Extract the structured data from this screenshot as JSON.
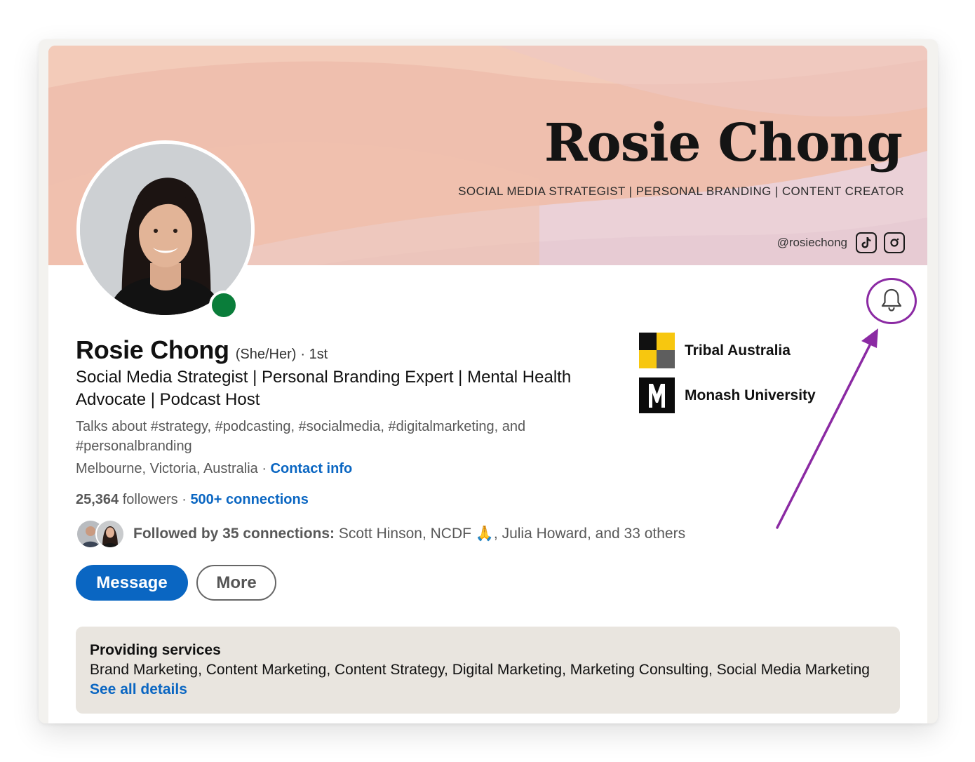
{
  "banner": {
    "name": "Rosie Chong",
    "tagline": "SOCIAL MEDIA STRATEGIST | PERSONAL BRANDING | CONTENT CREATOR",
    "handle": "@rosiechong",
    "social_icons": [
      "tiktok-icon",
      "instagram-icon"
    ],
    "colors": {
      "base": "#efbfae",
      "wave_pink": "#ecd3d9",
      "wave_peach": "#f5d0bc"
    }
  },
  "profile": {
    "name": "Rosie Chong",
    "pronouns": "(She/Her)",
    "degree": "· 1st",
    "headline": "Social Media Strategist | Personal Branding Expert | Mental Health Advocate | Podcast Host",
    "talks_about": "Talks about #strategy, #podcasting, #socialmedia, #digitalmarketing, and #personalbranding",
    "location": "Melbourne, Victoria, Australia",
    "location_separator": " · ",
    "contact_info": "Contact info",
    "followers_count": "25,364",
    "followers_label": " followers",
    "stats_separator": " · ",
    "connections": "500+ connections",
    "followed_by_label": "Followed by 35 connections:",
    "followed_by_names": " Scott Hinson, NCDF 🙏, Julia Howard, and 33 others",
    "presence": "online"
  },
  "actions": {
    "message": "Message",
    "more": "More",
    "bell": "bell-icon"
  },
  "experience": [
    {
      "label": "Tribal Australia",
      "icon": "tribal-australia-logo"
    },
    {
      "label": "Monash University",
      "icon": "monash-university-logo"
    }
  ],
  "services": {
    "title": "Providing services",
    "list": "Brand Marketing, Content Marketing, Content Strategy, Digital Marketing, Marketing Consulting, Social Media Marketing",
    "link": "See all details"
  },
  "colors": {
    "brand_blue": "#0a66c2",
    "presence_green": "#0a7d3a",
    "annotation_purple": "#8b2aa3",
    "services_bg": "#e9e5df"
  }
}
